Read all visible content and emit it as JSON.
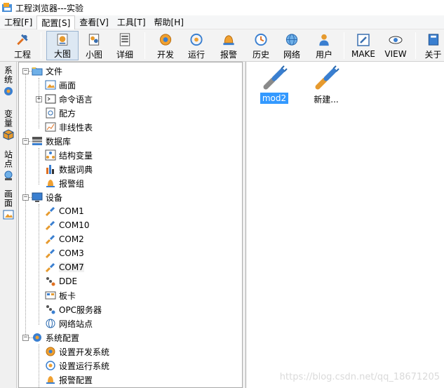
{
  "window": {
    "title": "工程浏览器---实验"
  },
  "menubar": {
    "items": [
      {
        "label": "工程[F]"
      },
      {
        "label": "配置[S]"
      },
      {
        "label": "查看[V]"
      },
      {
        "label": "工具[T]"
      },
      {
        "label": "帮助[H]"
      }
    ]
  },
  "toolbar": {
    "buttons": [
      {
        "label": "工程",
        "icon": "wrench-icon"
      },
      {
        "label": "大图",
        "icon": "large-icons-icon"
      },
      {
        "label": "小图",
        "icon": "small-icons-icon"
      },
      {
        "label": "详细",
        "icon": "details-icon"
      },
      {
        "label": "开发",
        "icon": "gear-icon"
      },
      {
        "label": "运行",
        "icon": "run-icon"
      },
      {
        "label": "报警",
        "icon": "bell-icon"
      },
      {
        "label": "历史",
        "icon": "history-icon"
      },
      {
        "label": "网络",
        "icon": "globe-icon"
      },
      {
        "label": "用户",
        "icon": "user-icon"
      },
      {
        "label": "MAKE",
        "icon": "pencil-icon"
      },
      {
        "label": "VIEW",
        "icon": "eye-icon"
      },
      {
        "label": "关于",
        "icon": "book-icon"
      }
    ]
  },
  "vtabs": [
    {
      "label": "系统"
    },
    {
      "label": "变量"
    },
    {
      "label": "站点"
    },
    {
      "label": "画面"
    }
  ],
  "tree": {
    "nodes": [
      {
        "label": "文件"
      },
      {
        "label": "画面"
      },
      {
        "label": "命令语言"
      },
      {
        "label": "配方"
      },
      {
        "label": "非线性表"
      },
      {
        "label": "数据库"
      },
      {
        "label": "结构变量"
      },
      {
        "label": "数据词典"
      },
      {
        "label": "报警组"
      },
      {
        "label": "设备"
      },
      {
        "label": "COM1"
      },
      {
        "label": "COM10"
      },
      {
        "label": "COM2"
      },
      {
        "label": "COM3"
      },
      {
        "label": "COM7"
      },
      {
        "label": "DDE"
      },
      {
        "label": "板卡"
      },
      {
        "label": "OPC服务器"
      },
      {
        "label": "网络站点"
      },
      {
        "label": "系统配置"
      },
      {
        "label": "设置开发系统"
      },
      {
        "label": "设置运行系统"
      },
      {
        "label": "报警配置"
      }
    ]
  },
  "content": {
    "items": [
      {
        "label": "mod2"
      },
      {
        "label": "新建..."
      }
    ]
  },
  "watermark": "https://blog.csdn.net/qq_18671205"
}
